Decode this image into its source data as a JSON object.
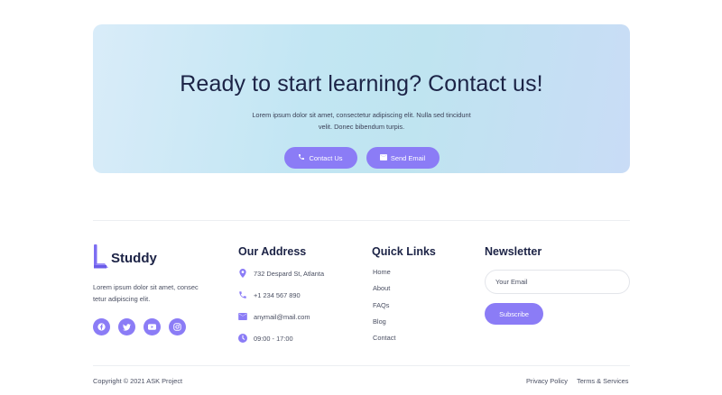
{
  "cta": {
    "title": "Ready to start learning? Contact us!",
    "text_line1": "Lorem ipsum dolor sit amet, consectetur adipiscing elit. Nulla sed tincidunt",
    "text_line2": "velit. Donec bibendum turpis.",
    "contact_label": "Contact Us",
    "send_label": "Send Email"
  },
  "brand": {
    "name": "Studdy",
    "about_line1": "Lorem ipsum dolor sit amet, consec",
    "about_line2": "tetur adipiscing elit.",
    "socials": [
      "facebook-icon",
      "twitter-icon",
      "youtube-icon",
      "instagram-icon"
    ]
  },
  "address": {
    "title": "Our Address",
    "items": [
      {
        "icon": "map-pin-icon",
        "text": "732 Despard St, Atlanta"
      },
      {
        "icon": "phone-icon",
        "text": "+1 234 567 890"
      },
      {
        "icon": "mail-icon",
        "text": "anymail@mail.com"
      },
      {
        "icon": "clock-icon",
        "text": "09:00 - 17:00"
      }
    ]
  },
  "quick_links": {
    "title": "Quick Links",
    "items": [
      "Home",
      "About",
      "FAQs",
      "Blog",
      "Contact"
    ]
  },
  "newsletter": {
    "title": "Newsletter",
    "placeholder": "Your Email",
    "button_label": "Subscribe"
  },
  "footer": {
    "copyright": "Copyright © 2021 ASK Project",
    "privacy": "Privacy Policy",
    "terms": "Terms & Services"
  },
  "colors": {
    "accent": "#8b7cf6",
    "heading": "#1c2346",
    "text": "#4a4f62"
  }
}
